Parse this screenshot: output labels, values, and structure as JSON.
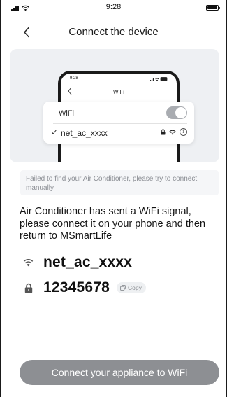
{
  "status_bar": {
    "time": "9:28",
    "icons": [
      "signal-icon",
      "wifi-icon",
      "battery-icon"
    ]
  },
  "header": {
    "back_icon": "chevron-left-icon",
    "title": "Connect  the device"
  },
  "illustration": {
    "mini_phone": {
      "time": "9:28",
      "status_icons": "..ıl ᯤ ▬",
      "title": "WiFi"
    },
    "wifi_card": {
      "label": "WiFi",
      "toggle_on": true,
      "check": "✓",
      "ssid": "net_ac_xxxx",
      "icons": [
        "lock-icon",
        "wifi-icon",
        "info-icon"
      ]
    }
  },
  "notice": {
    "text": "Failed to find your Air Conditioner, please try to connect manually"
  },
  "message": {
    "text": "Air Conditioner has sent a WiFi signal, please connect it on your phone and then return to MSmartLife"
  },
  "credentials": {
    "ssid": "net_ac_xxxx",
    "password": "12345678",
    "copy_label": "Copy"
  },
  "actions": {
    "primary_label": "Connect your appliance to WiFi"
  },
  "colors": {
    "illustration_bg": "#eef0f3",
    "button_bg": "#8d8f93",
    "toggle_bg": "#a9acb1",
    "notice_bg": "#f5f6f8",
    "notice_text": "#8b8e94"
  }
}
